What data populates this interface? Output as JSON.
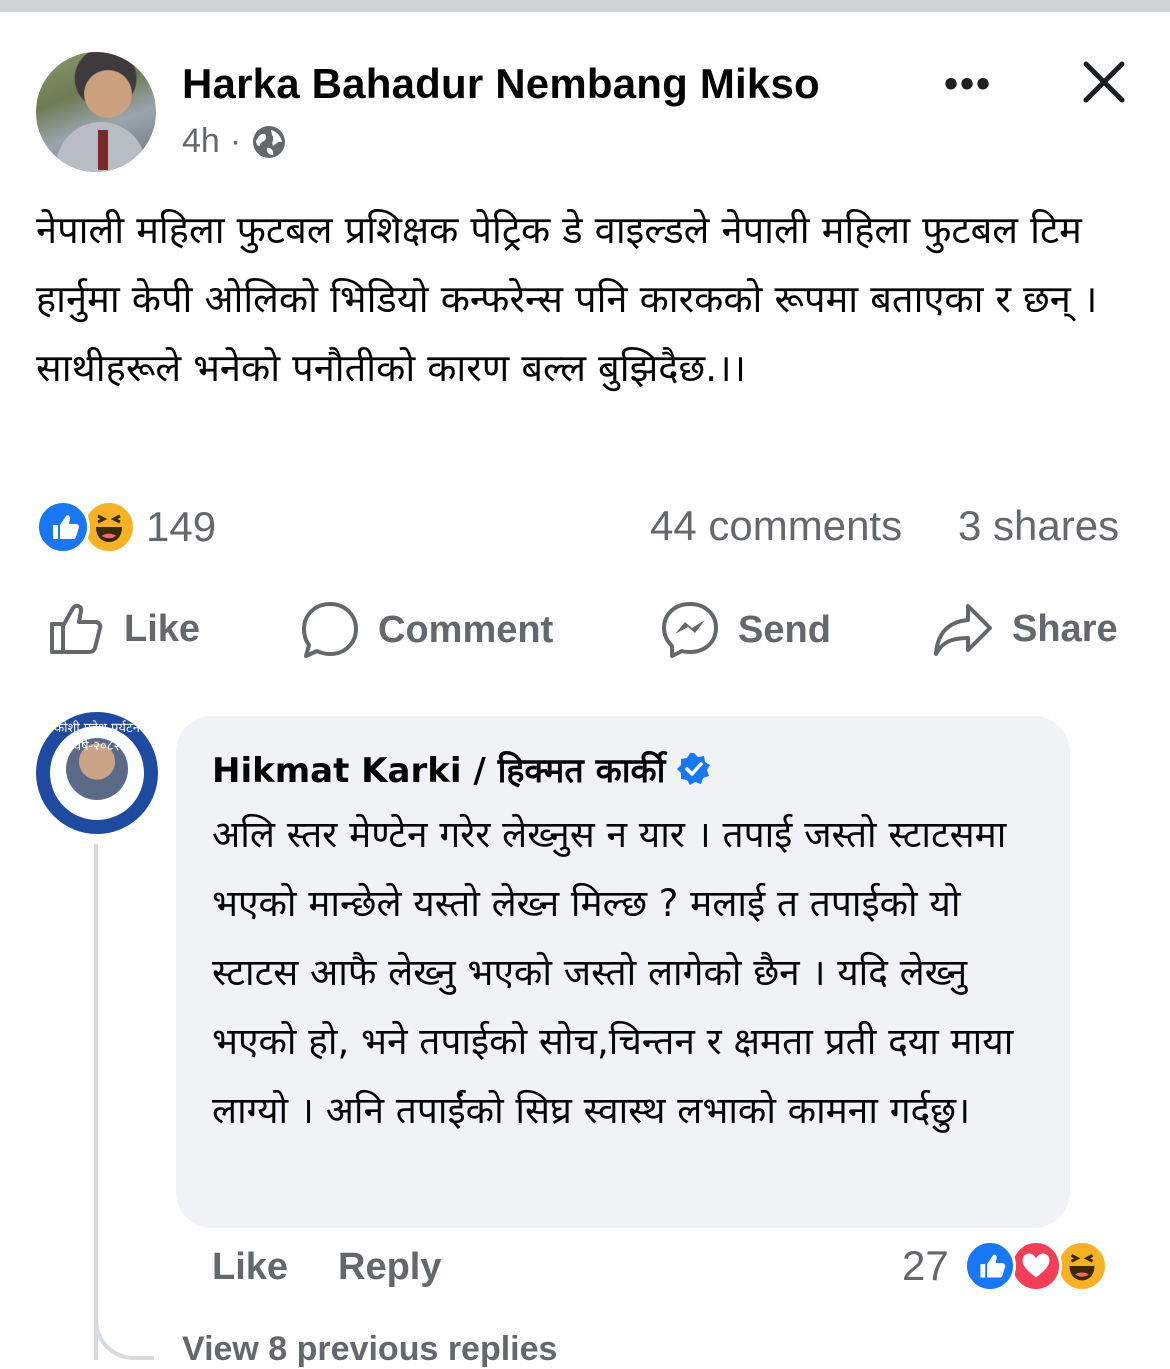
{
  "post": {
    "author": "Harka Bahadur Nembang Mikso",
    "time": "4h",
    "separator": "·",
    "more_label": "•••",
    "text": "नेपाली महिला फुटबल प्रशिक्षक पेट्रिक डे वाइल्डले नेपाली महिला फुटबल टिम हार्नुमा केपी ओलिको भिडियो कन्फरेन्स पनि कारकको रूपमा बताएका र छन् । साथीहरूले भनेको पनौतीको कारण बल्ल बुझिदैछ.।।",
    "reaction_count": "149",
    "comments_count": "44 comments",
    "shares_count": "3 shares"
  },
  "actions": {
    "like": "Like",
    "comment": "Comment",
    "send": "Send",
    "share": "Share"
  },
  "comment": {
    "author": "Hikmat Karki / हिक्मत कार्की",
    "avatar_text": "कोशी प्रदेश पर्यटन वर्ष-२०८२",
    "verified": true,
    "text": "अलि स्तर मेण्टेन गरेर लेख्नुस न यार । तपाई जस्तो स्टाटसमा भएको मान्छेले यस्तो लेख्न मिल्छ ? मलाई त तपाईको यो स्टाटस आफै लेख्नु भएको जस्तो लागेको छैन । यदि लेख्नु भएको हो, भने तपाईको सोच,चिन्तन र क्षमता प्रती दया माया लाग्यो । अनि तपाईंको सिघ्र स्वास्थ लभाको कामना गर्दछु।",
    "like_label": "Like",
    "reply_label": "Reply",
    "reaction_count": "27",
    "view_replies": "View 8 previous replies"
  },
  "colors": {
    "brand_blue": "#1877f2",
    "secondary_text": "#65676b",
    "bubble_bg": "#f0f2f5"
  },
  "icons": [
    "globe-icon",
    "close-icon",
    "like-icon",
    "comment-icon",
    "messenger-icon",
    "share-icon",
    "verified-badge-icon"
  ]
}
